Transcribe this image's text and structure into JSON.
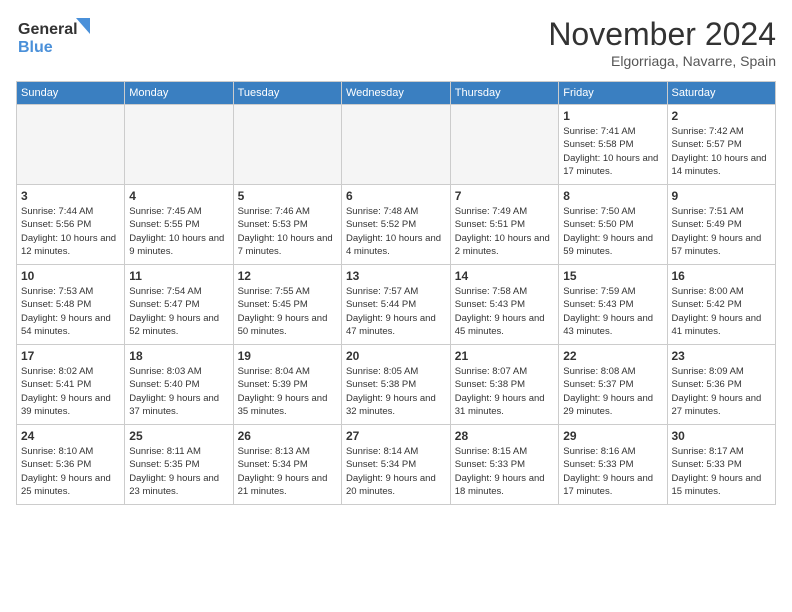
{
  "logo": {
    "line1": "General",
    "line2": "Blue"
  },
  "title": "November 2024",
  "location": "Elgorriaga, Navarre, Spain",
  "days_of_week": [
    "Sunday",
    "Monday",
    "Tuesday",
    "Wednesday",
    "Thursday",
    "Friday",
    "Saturday"
  ],
  "weeks": [
    [
      {
        "day": "",
        "info": ""
      },
      {
        "day": "",
        "info": ""
      },
      {
        "day": "",
        "info": ""
      },
      {
        "day": "",
        "info": ""
      },
      {
        "day": "",
        "info": ""
      },
      {
        "day": "1",
        "info": "Sunrise: 7:41 AM\nSunset: 5:58 PM\nDaylight: 10 hours and 17 minutes."
      },
      {
        "day": "2",
        "info": "Sunrise: 7:42 AM\nSunset: 5:57 PM\nDaylight: 10 hours and 14 minutes."
      }
    ],
    [
      {
        "day": "3",
        "info": "Sunrise: 7:44 AM\nSunset: 5:56 PM\nDaylight: 10 hours and 12 minutes."
      },
      {
        "day": "4",
        "info": "Sunrise: 7:45 AM\nSunset: 5:55 PM\nDaylight: 10 hours and 9 minutes."
      },
      {
        "day": "5",
        "info": "Sunrise: 7:46 AM\nSunset: 5:53 PM\nDaylight: 10 hours and 7 minutes."
      },
      {
        "day": "6",
        "info": "Sunrise: 7:48 AM\nSunset: 5:52 PM\nDaylight: 10 hours and 4 minutes."
      },
      {
        "day": "7",
        "info": "Sunrise: 7:49 AM\nSunset: 5:51 PM\nDaylight: 10 hours and 2 minutes."
      },
      {
        "day": "8",
        "info": "Sunrise: 7:50 AM\nSunset: 5:50 PM\nDaylight: 9 hours and 59 minutes."
      },
      {
        "day": "9",
        "info": "Sunrise: 7:51 AM\nSunset: 5:49 PM\nDaylight: 9 hours and 57 minutes."
      }
    ],
    [
      {
        "day": "10",
        "info": "Sunrise: 7:53 AM\nSunset: 5:48 PM\nDaylight: 9 hours and 54 minutes."
      },
      {
        "day": "11",
        "info": "Sunrise: 7:54 AM\nSunset: 5:47 PM\nDaylight: 9 hours and 52 minutes."
      },
      {
        "day": "12",
        "info": "Sunrise: 7:55 AM\nSunset: 5:45 PM\nDaylight: 9 hours and 50 minutes."
      },
      {
        "day": "13",
        "info": "Sunrise: 7:57 AM\nSunset: 5:44 PM\nDaylight: 9 hours and 47 minutes."
      },
      {
        "day": "14",
        "info": "Sunrise: 7:58 AM\nSunset: 5:43 PM\nDaylight: 9 hours and 45 minutes."
      },
      {
        "day": "15",
        "info": "Sunrise: 7:59 AM\nSunset: 5:43 PM\nDaylight: 9 hours and 43 minutes."
      },
      {
        "day": "16",
        "info": "Sunrise: 8:00 AM\nSunset: 5:42 PM\nDaylight: 9 hours and 41 minutes."
      }
    ],
    [
      {
        "day": "17",
        "info": "Sunrise: 8:02 AM\nSunset: 5:41 PM\nDaylight: 9 hours and 39 minutes."
      },
      {
        "day": "18",
        "info": "Sunrise: 8:03 AM\nSunset: 5:40 PM\nDaylight: 9 hours and 37 minutes."
      },
      {
        "day": "19",
        "info": "Sunrise: 8:04 AM\nSunset: 5:39 PM\nDaylight: 9 hours and 35 minutes."
      },
      {
        "day": "20",
        "info": "Sunrise: 8:05 AM\nSunset: 5:38 PM\nDaylight: 9 hours and 32 minutes."
      },
      {
        "day": "21",
        "info": "Sunrise: 8:07 AM\nSunset: 5:38 PM\nDaylight: 9 hours and 31 minutes."
      },
      {
        "day": "22",
        "info": "Sunrise: 8:08 AM\nSunset: 5:37 PM\nDaylight: 9 hours and 29 minutes."
      },
      {
        "day": "23",
        "info": "Sunrise: 8:09 AM\nSunset: 5:36 PM\nDaylight: 9 hours and 27 minutes."
      }
    ],
    [
      {
        "day": "24",
        "info": "Sunrise: 8:10 AM\nSunset: 5:36 PM\nDaylight: 9 hours and 25 minutes."
      },
      {
        "day": "25",
        "info": "Sunrise: 8:11 AM\nSunset: 5:35 PM\nDaylight: 9 hours and 23 minutes."
      },
      {
        "day": "26",
        "info": "Sunrise: 8:13 AM\nSunset: 5:34 PM\nDaylight: 9 hours and 21 minutes."
      },
      {
        "day": "27",
        "info": "Sunrise: 8:14 AM\nSunset: 5:34 PM\nDaylight: 9 hours and 20 minutes."
      },
      {
        "day": "28",
        "info": "Sunrise: 8:15 AM\nSunset: 5:33 PM\nDaylight: 9 hours and 18 minutes."
      },
      {
        "day": "29",
        "info": "Sunrise: 8:16 AM\nSunset: 5:33 PM\nDaylight: 9 hours and 17 minutes."
      },
      {
        "day": "30",
        "info": "Sunrise: 8:17 AM\nSunset: 5:33 PM\nDaylight: 9 hours and 15 minutes."
      }
    ]
  ]
}
